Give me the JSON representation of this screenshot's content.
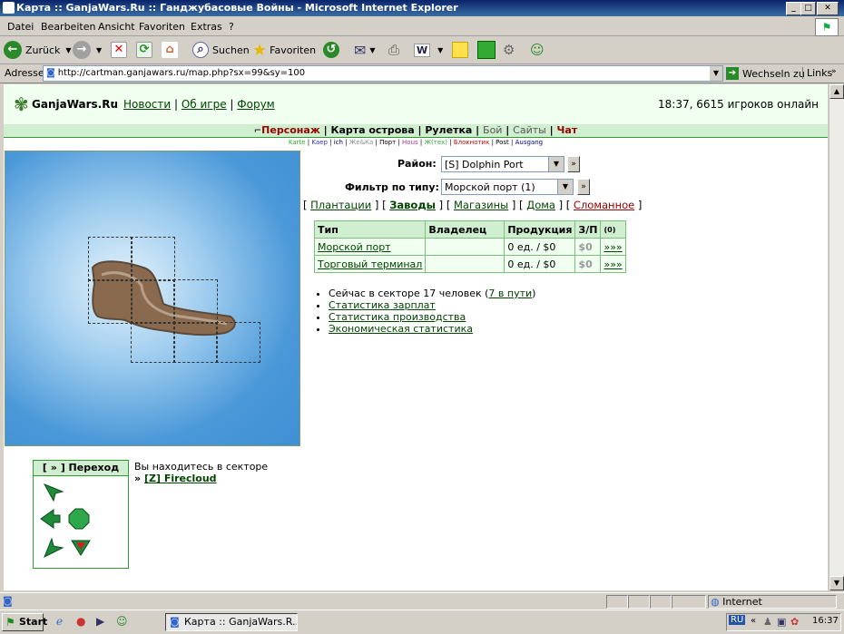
{
  "window": {
    "title": "Карта :: GanjaWars.Ru :: Ганджубасовые Войны - Microsoft Internet Explorer",
    "controls": [
      "_",
      "□",
      "✕"
    ]
  },
  "menu": [
    "Datei",
    "Bearbeiten",
    "Ansicht",
    "Favoriten",
    "Extras",
    "?"
  ],
  "toolbar": {
    "back": "Zurück",
    "search": "Suchen",
    "favorites": "Favoriten"
  },
  "address": {
    "label": "Adresse",
    "url": "http://cartman.ganjawars.ru/map.php?sx=99&sy=100",
    "go": "Wechseln zu",
    "links": "Links"
  },
  "header": {
    "logo": "GanjaWars.Ru",
    "sep": ":",
    "nav": [
      "Новости",
      "Об игре",
      "Форум"
    ],
    "status": "18:37, 6615 игроков онлайн"
  },
  "mainnav": [
    {
      "label": "Персонаж",
      "red": true
    },
    {
      "label": "Карта острова",
      "red": false
    },
    {
      "label": "Рулетка",
      "red": false
    },
    {
      "label": "Бой",
      "red": false,
      "light": true
    },
    {
      "label": "Сайты",
      "red": false,
      "light": true
    },
    {
      "label": "Чат",
      "red": true
    }
  ],
  "subnav": [
    {
      "label": "Karte",
      "color": "#33aa33"
    },
    {
      "label": "Kaep",
      "color": "#3333cc"
    },
    {
      "label": "ich",
      "color": "#000088"
    },
    {
      "label": "Же&Ка",
      "color": "#888888"
    },
    {
      "label": "Порт",
      "color": "#000000"
    },
    {
      "label": "Hous",
      "color": "#aa3399"
    },
    {
      "label": "Ж(тех)",
      "color": "#33aa33"
    },
    {
      "label": "Блокнотик",
      "color": "#cc0000"
    },
    {
      "label": "Post",
      "color": "#000000"
    },
    {
      "label": "Ausgang",
      "color": "#000088"
    }
  ],
  "filters": {
    "district_label": "Район:",
    "district_value": "[S] Dolphin Port",
    "type_label": "Фильтр по типу:",
    "type_value": "Морской порт (1)",
    "go": "»"
  },
  "categories": [
    {
      "label": "Плантации",
      "bold": false,
      "red": false
    },
    {
      "label": "Заводы",
      "bold": true,
      "red": false
    },
    {
      "label": "Магазины",
      "bold": false,
      "red": false
    },
    {
      "label": "Дома",
      "bold": false,
      "red": false
    },
    {
      "label": "Сломанное",
      "bold": false,
      "red": true
    }
  ],
  "table": {
    "headers": [
      "Тип",
      "Владелец",
      "Продукция",
      "З/П",
      "(0)"
    ],
    "rows": [
      {
        "type": "Морской порт",
        "owner": "",
        "product": "0 ед. / $0",
        "salary": "$0",
        "action": "»»»"
      },
      {
        "type": "Торговый терминал",
        "owner": "",
        "product": "0 ед. / $0",
        "salary": "$0",
        "action": "»»»"
      }
    ]
  },
  "info": {
    "sector_people_prefix": "Сейчас в секторе 17 человек (",
    "in_transit": "7 в пути",
    "sector_people_suffix": ")",
    "links": [
      "Статистика зарплат",
      "Статистика производства",
      "Экономическая статистика"
    ]
  },
  "jump": {
    "title": "[ » ] Переход"
  },
  "location": {
    "text": "Вы находитесь в секторе",
    "prefix": "»",
    "sector": "[Z] Firecloud"
  },
  "statusbar": {
    "zone": "Internet"
  },
  "taskbar": {
    "start": "Start",
    "item": "Карта :: GanjaWars.R...",
    "lang": "RU",
    "clock": "16:37"
  }
}
